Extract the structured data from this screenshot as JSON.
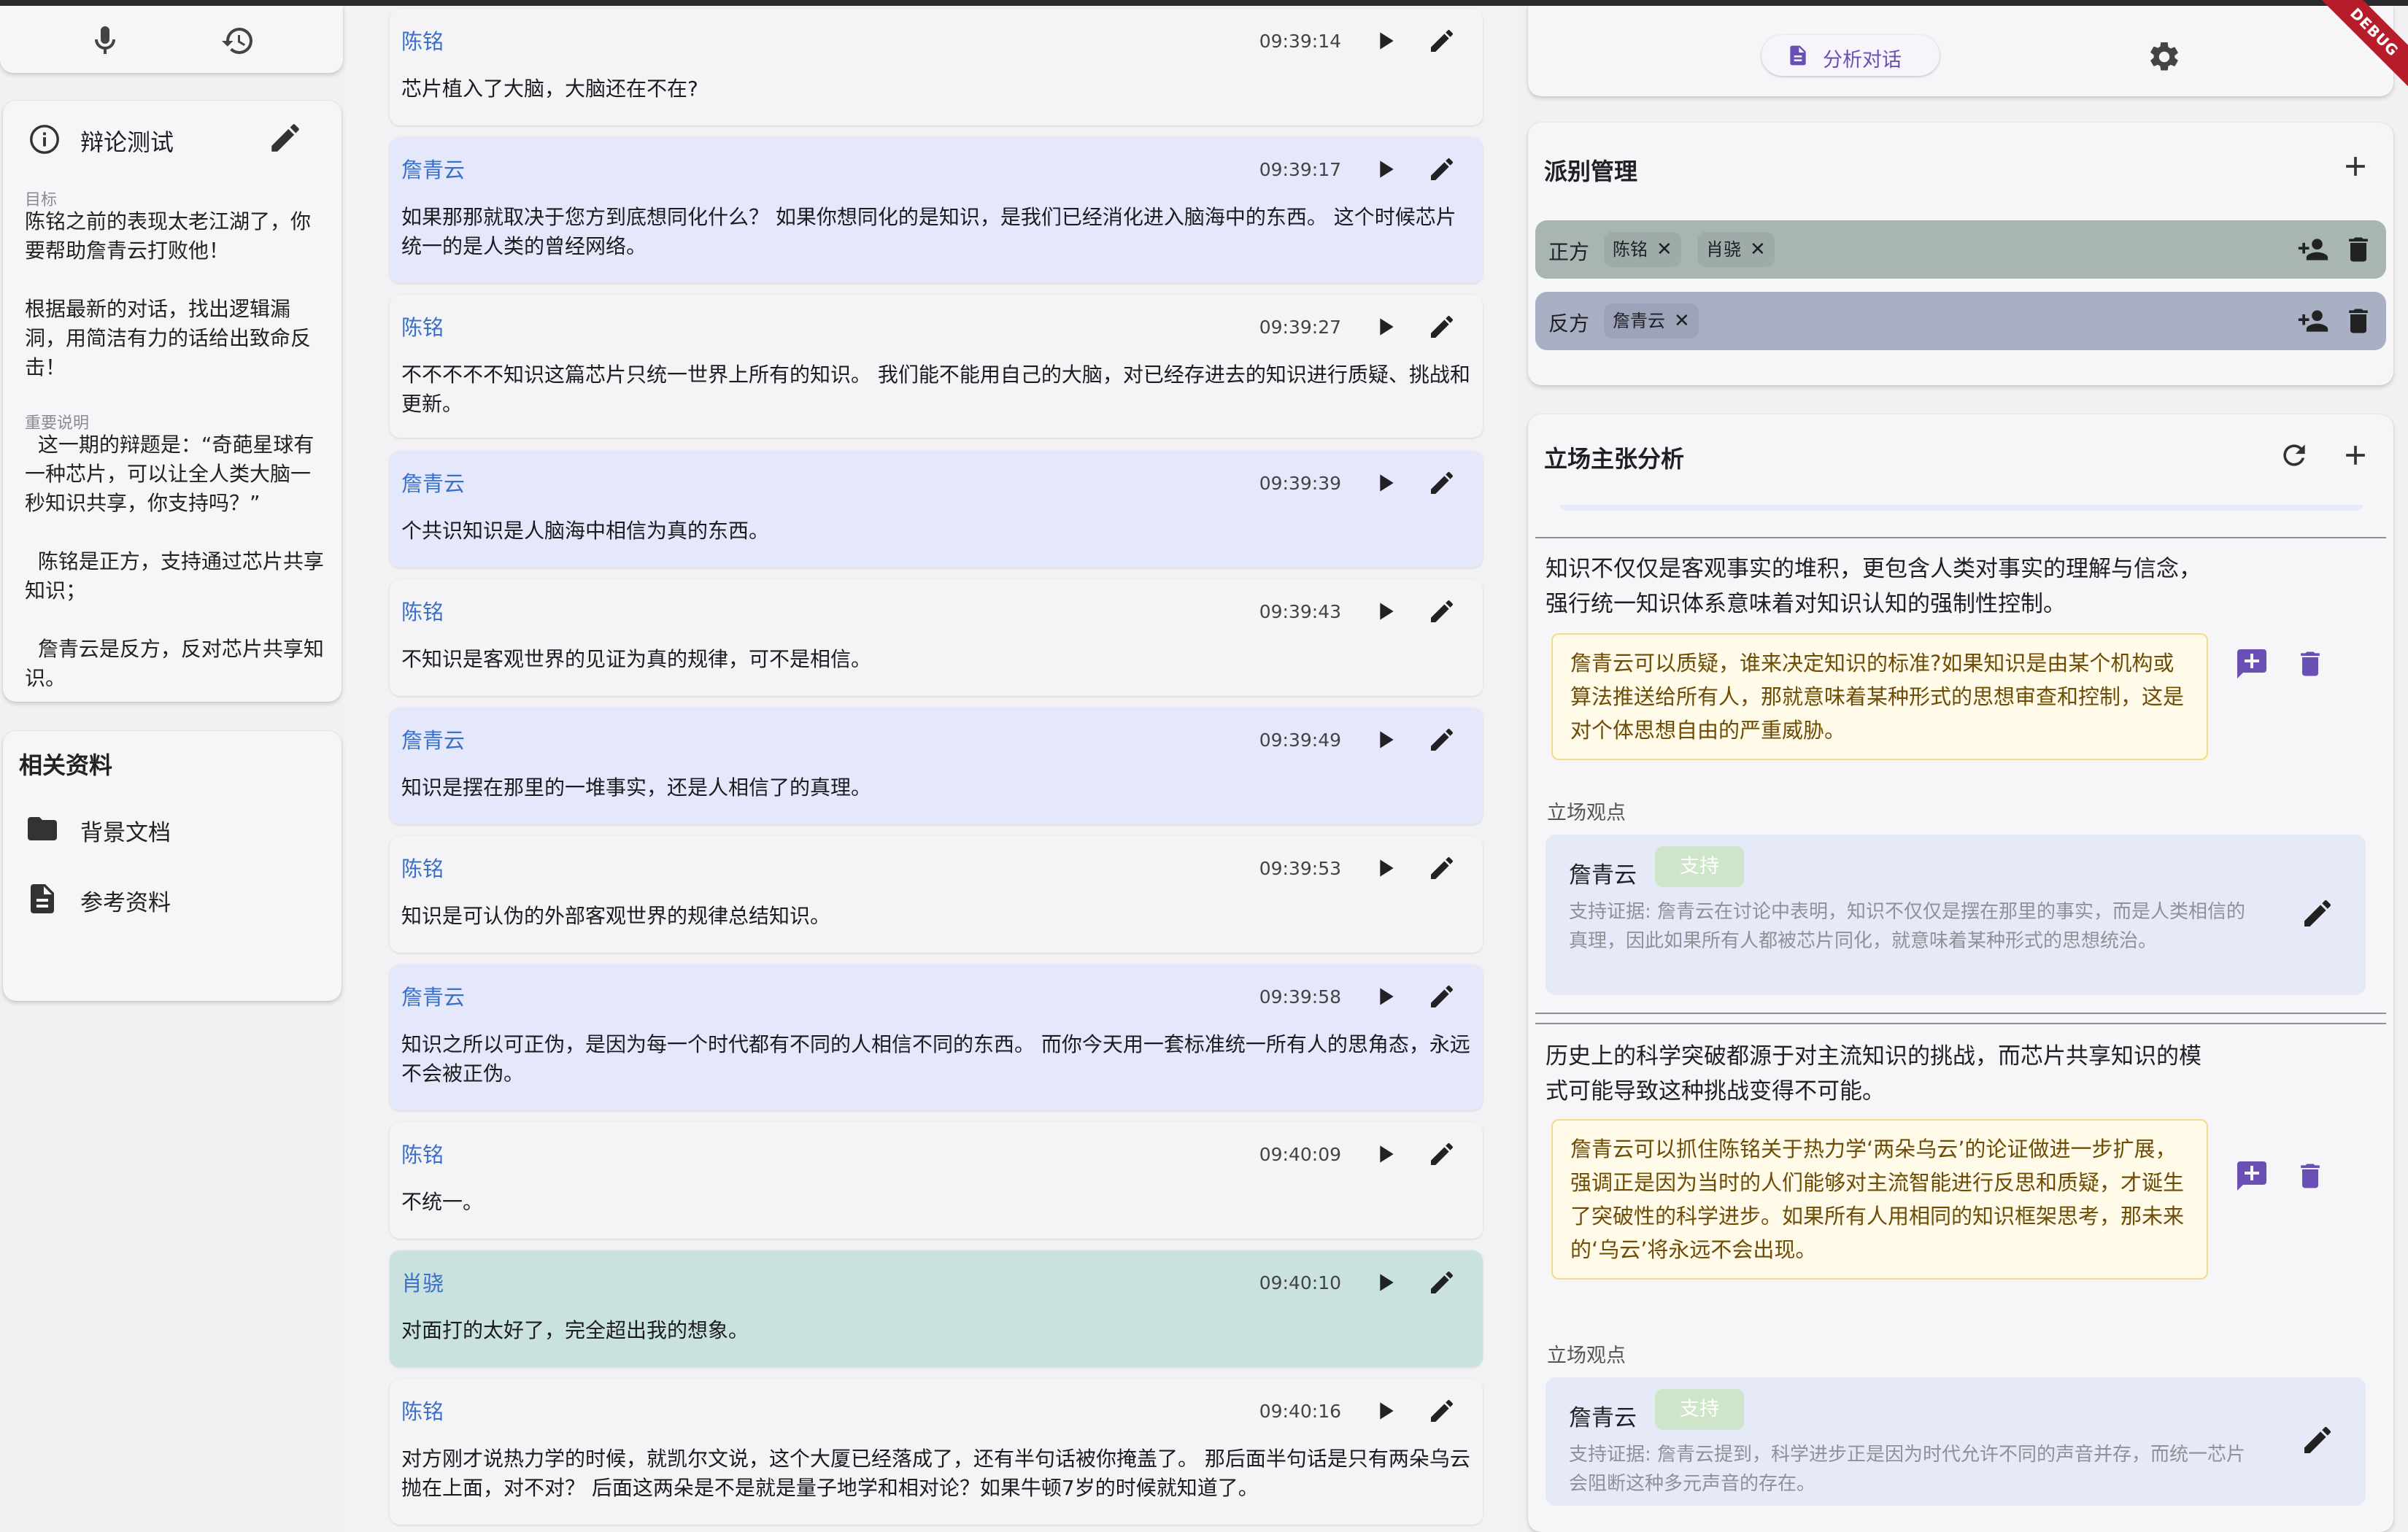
{
  "left": {
    "toolbar": {
      "mic_icon": "mic-icon",
      "history_icon": "history-icon"
    },
    "info": {
      "title": "辩论测试",
      "goal_label": "目标",
      "goal_text": "陈铭之前的表现太老江湖了，你要帮助詹青云打败他！\n\n根据最新的对话，找出逻辑漏洞，用简洁有力的话给出致命反击！",
      "notes_label": "重要说明",
      "notes_text": "  这一期的辩题是：“奇葩星球有一种芯片，可以让全人类大脑一秒知识共享，你支持吗？”\n\n  陈铭是正方，支持通过芯片共享知识；\n\n  詹青云是反方，反对芯片共享知识。"
    },
    "resources": {
      "title": "相关资料",
      "items": [
        {
          "label": "背景文档",
          "icon": "folder-icon"
        },
        {
          "label": "参考资料",
          "icon": "document-icon"
        }
      ]
    }
  },
  "messages": [
    {
      "speaker": "陈铭",
      "time": "09:39:14",
      "text": "芯片植入了大脑，大脑还在不在?",
      "kind": "pro"
    },
    {
      "speaker": "詹青云",
      "time": "09:39:17",
      "text": "如果那那就取决于您方到底想同化什么？ 如果你想同化的是知识，是我们已经消化进入脑海中的东西。 这个时候芯片统一的是人类的曾经网络。",
      "kind": "con"
    },
    {
      "speaker": "陈铭",
      "time": "09:39:27",
      "text": "不不不不不知识这篇芯片只统一世界上所有的知识。 我们能不能用自己的大脑，对已经存进去的知识进行质疑、挑战和更新。",
      "kind": "pro"
    },
    {
      "speaker": "詹青云",
      "time": "09:39:39",
      "text": "个共识知识是人脑海中相信为真的东西。",
      "kind": "con"
    },
    {
      "speaker": "陈铭",
      "time": "09:39:43",
      "text": "不知识是客观世界的见证为真的规律，可不是相信。",
      "kind": "pro"
    },
    {
      "speaker": "詹青云",
      "time": "09:39:49",
      "text": "知识是摆在那里的一堆事实，还是人相信了的真理。",
      "kind": "con"
    },
    {
      "speaker": "陈铭",
      "time": "09:39:53",
      "text": "知识是可认伪的外部客观世界的规律总结知识。",
      "kind": "pro"
    },
    {
      "speaker": "詹青云",
      "time": "09:39:58",
      "text": "知识之所以可正伪，是因为每一个时代都有不同的人相信不同的东西。 而你今天用一套标准统一所有人的思角态，永远不会被正伪。",
      "kind": "con"
    },
    {
      "speaker": "陈铭",
      "time": "09:40:09",
      "text": "不统一。",
      "kind": "pro"
    },
    {
      "speaker": "肖骁",
      "time": "09:40:10",
      "text": "对面打的太好了，完全超出我的想象。",
      "kind": "teal"
    },
    {
      "speaker": "陈铭",
      "time": "09:40:16",
      "text": "对方刚才说热力学的时候，就凯尔文说，这个大厦已经落成了，还有半句话被你掩盖了。 那后面半句话是只有两朵乌云抛在上面，对不对？ 后面这两朵是不是就是量子地学和相对论？如果牛顿7岁的时候就知道了。",
      "kind": "pro"
    }
  ],
  "right": {
    "toolbar": {
      "analyze_label": "分析对话",
      "analyze_icon": "document-analyze-icon",
      "settings_icon": "gear-icon"
    },
    "factions": {
      "title": "派别管理",
      "rows": [
        {
          "label": "正方",
          "members": [
            "陈铭",
            "肖骁"
          ],
          "bg": "#a9b5b3"
        },
        {
          "label": "反方",
          "members": [
            "詹青云"
          ],
          "bg": "#aab0c3"
        }
      ]
    },
    "stance": {
      "title": "立场主张分析",
      "claims": [
        {
          "claim": "知识不仅仅是客观事实的堆积，更包含人类对事实的理解与信念，强行统一知识体系意味着对知识认知的强制性控制。",
          "rebuttal": "詹青云可以质疑，谁来决定知识的标准?如果知识是由某个机构或算法推送给所有人，那就意味着某种形式的思想审查和控制，这是对个体思想自由的严重威胁。",
          "view_label": "立场观点",
          "view": {
            "speaker": "詹青云",
            "badge": "支持",
            "evidence": "支持证据: 詹青云在讨论中表明，知识不仅仅是摆在那里的事实，而是人类相信的真理，因此如果所有人都被芯片同化，就意味着某种形式的思想统治。"
          }
        },
        {
          "claim": "历史上的科学突破都源于对主流知识的挑战，而芯片共享知识的模式可能导致这种挑战变得不可能。",
          "rebuttal": "詹青云可以抓住陈铭关于热力学‘两朵乌云’的论证做进一步扩展，强调正是因为当时的人们能够对主流智能进行反思和质疑，才诞生了突破性的科学进步。如果所有人用相同的知识框架思考，那未来的‘乌云’将永远不会出现。",
          "view_label": "立场观点",
          "view": {
            "speaker": "詹青云",
            "badge": "支持",
            "evidence": "支持证据: 詹青云提到，科学进步正是因为时代允许不同的声音并存，而统一芯片会阻断这种多元声音的存在。"
          }
        }
      ]
    }
  },
  "debug_label": "DEBUG",
  "colors": {
    "speaker_blue": "#3b70c9",
    "con_bg": "#e4e8fa",
    "teal_bg": "#c9e2e0",
    "accent_purple": "#6a4fb5",
    "rebuttal_bg": "#fffbe8",
    "rebuttal_text": "#6e4c06",
    "support_badge": "#cfe5c9"
  }
}
